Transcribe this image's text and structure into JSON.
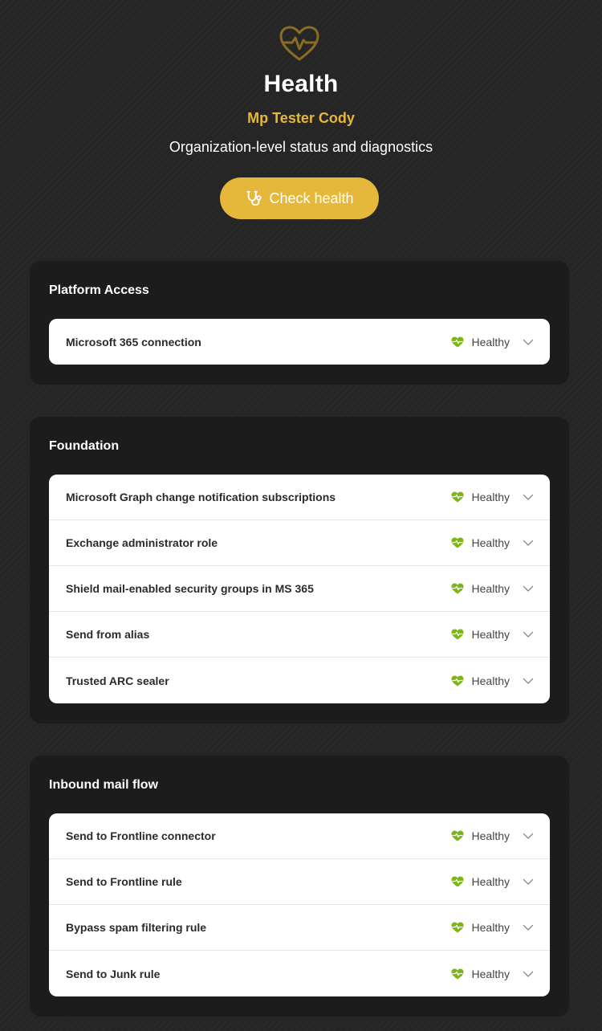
{
  "header": {
    "title": "Health",
    "org_name": "Mp Tester Cody",
    "subtitle": "Organization-level status and diagnostics",
    "check_button_label": "Check health",
    "logo_icon": "heartbeat-icon",
    "accent_color": "#e5b73b"
  },
  "status_color": "#7cb518",
  "sections": [
    {
      "title": "Platform Access",
      "items": [
        {
          "label": "Microsoft 365 connection",
          "status": "Healthy"
        }
      ]
    },
    {
      "title": "Foundation",
      "items": [
        {
          "label": "Microsoft Graph change notification subscriptions",
          "status": "Healthy"
        },
        {
          "label": "Exchange administrator role",
          "status": "Healthy"
        },
        {
          "label": "Shield mail-enabled security groups in MS 365",
          "status": "Healthy"
        },
        {
          "label": "Send from alias",
          "status": "Healthy"
        },
        {
          "label": "Trusted ARC sealer",
          "status": "Healthy"
        }
      ]
    },
    {
      "title": "Inbound mail flow",
      "items": [
        {
          "label": "Send to Frontline connector",
          "status": "Healthy"
        },
        {
          "label": "Send to Frontline rule",
          "status": "Healthy"
        },
        {
          "label": "Bypass spam filtering rule",
          "status": "Healthy"
        },
        {
          "label": "Send to Junk rule",
          "status": "Healthy"
        }
      ]
    }
  ]
}
